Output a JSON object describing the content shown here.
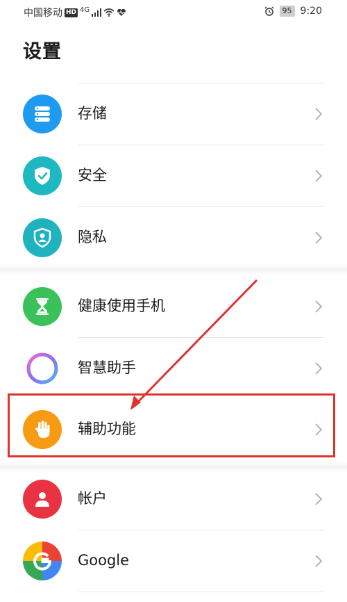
{
  "status_bar": {
    "carrier": "中国移动",
    "hd": "HD",
    "network": "4G",
    "battery": "95",
    "time": "9:20"
  },
  "page": {
    "title": "设置"
  },
  "rows": [
    {
      "label": "存储",
      "icon": "storage-icon",
      "color": "#1e9bf0"
    },
    {
      "label": "安全",
      "icon": "shield-check-icon",
      "color": "#1eb8c3"
    },
    {
      "label": "隐私",
      "icon": "privacy-icon",
      "color": "#1eb3bf"
    },
    {
      "label": "健康使用手机",
      "icon": "hourglass-icon",
      "color": "#3ac15a"
    },
    {
      "label": "智慧助手",
      "icon": "assistant-ring-icon",
      "color": "#a071f0"
    },
    {
      "label": "辅助功能",
      "icon": "hand-icon",
      "color": "#f89a12"
    },
    {
      "label": "帐户",
      "icon": "account-icon",
      "color": "#ea3342"
    },
    {
      "label": "Google",
      "icon": "google-icon",
      "color": "#4285f4"
    }
  ],
  "annotation": {
    "highlight_color": "#e0312d"
  }
}
